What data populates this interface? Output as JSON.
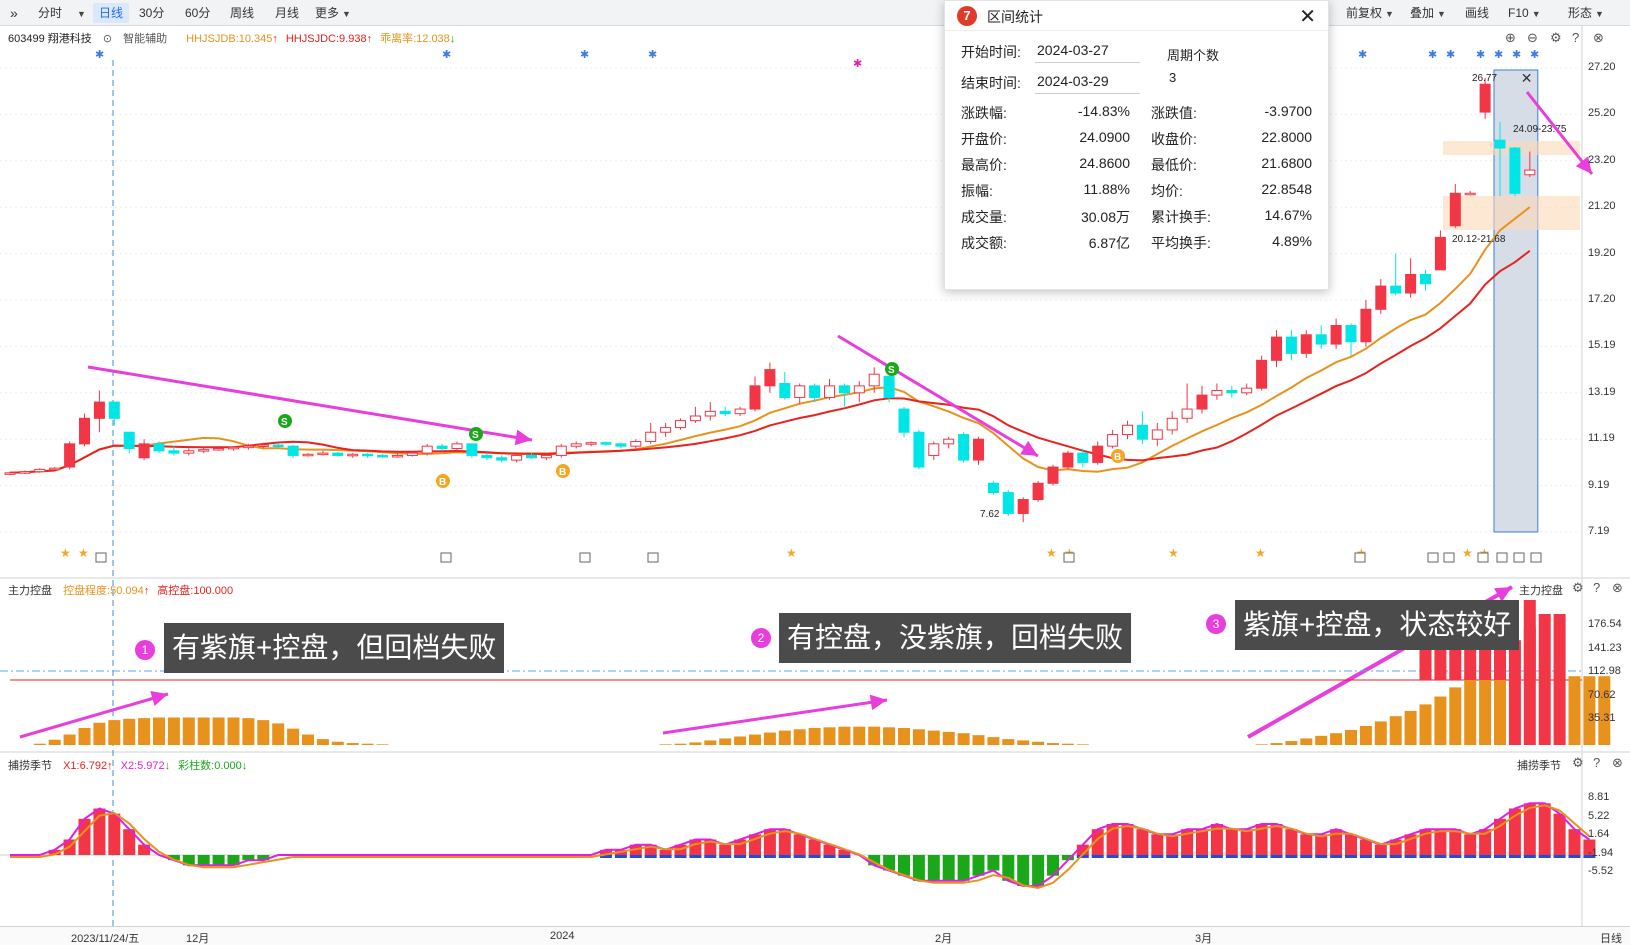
{
  "toolbar": {
    "expand_icon": "double-chevron-right-icon",
    "periods": [
      "分时",
      "日线",
      "30分",
      "60分",
      "周线",
      "月线",
      "更多"
    ],
    "active_period": "日线",
    "right": [
      "前复权",
      "叠加",
      "画线",
      "F10",
      "形态"
    ]
  },
  "stock": {
    "code_name": "603499 翔港科技",
    "assist": "智能辅助"
  },
  "main_indicators": [
    {
      "label": "HHJSJDB:10.345",
      "color": "#e8921e",
      "arrow": "↑",
      "arrow_color": "#e8221e"
    },
    {
      "label": "HHJSJDC:9.938",
      "color": "#e8221e",
      "arrow": "↑",
      "arrow_color": "#e8221e"
    },
    {
      "label": "乖离率:12.038",
      "color": "#e8921e",
      "arrow": "↓",
      "arrow_color": "#1aa81a"
    }
  ],
  "price_axis": [
    "27.20",
    "25.20",
    "23.20",
    "21.20",
    "19.20",
    "17.20",
    "15.19",
    "13.19",
    "11.19",
    "9.19",
    "7.19"
  ],
  "price_annotations": {
    "high": "26.77",
    "range1": "24.09-23.75",
    "range2": "20.12-21.68",
    "low": "7.62"
  },
  "control_panel": {
    "name": "主力控盘",
    "indicators": [
      {
        "label": "控盘程度:50.094",
        "color": "#e8921e",
        "arrow": "↑",
        "arrow_color": "#e8221e"
      },
      {
        "label": "高控盘:100.000",
        "color": "#e8221e"
      }
    ],
    "axis": [
      "176.54",
      "141.23",
      "112.98",
      "70.62",
      "35.31"
    ],
    "right_label": "主力控盘"
  },
  "season_panel": {
    "name": "捕捞季节",
    "indicators": [
      {
        "label": "X1:6.792",
        "color": "#e8221e",
        "arrow": "↑",
        "arrow_color": "#e8221e"
      },
      {
        "label": "X2:5.972",
        "color": "#e020e0",
        "arrow": "↓",
        "arrow_color": "#1aa81a"
      },
      {
        "label": "彩柱数:0.000",
        "color": "#1aa81a",
        "arrow": "↓",
        "arrow_color": "#1aa81a"
      }
    ],
    "axis": [
      "8.81",
      "5.22",
      "1.64",
      "-1.94",
      "-5.52"
    ],
    "right_label": "捕捞季节"
  },
  "dates": [
    "2023/11/24/五",
    "12月",
    "2024",
    "2月",
    "3月"
  ],
  "period_label": "日线",
  "stats": {
    "title": "区间统计",
    "start_label": "开始时间:",
    "start_value": "2024-03-27",
    "end_label": "结束时间:",
    "end_value": "2024-03-29",
    "period_count_label": "周期个数",
    "period_count": "3",
    "rows": [
      [
        "涨跌幅:",
        "-14.83%",
        "涨跌值:",
        "-3.9700"
      ],
      [
        "开盘价:",
        "24.0900",
        "收盘价:",
        "22.8000"
      ],
      [
        "最高价:",
        "24.8600",
        "最低价:",
        "21.6800"
      ],
      [
        "振幅:",
        "11.88%",
        "均价:",
        "22.8548"
      ],
      [
        "成交量:",
        "30.08万",
        "累计换手:",
        "14.67%"
      ],
      [
        "成交额:",
        "6.87亿",
        "平均换手:",
        "4.89%"
      ]
    ]
  },
  "annotations": [
    {
      "num": "1",
      "text": "有紫旗+控盘，但回档失败"
    },
    {
      "num": "2",
      "text": "有控盘，没紫旗，回档失败"
    },
    {
      "num": "3",
      "text": "紫旗+控盘，状态较好"
    }
  ],
  "colors": {
    "up": "#f23645",
    "down": "#00e5e5",
    "ma1": "#e8921e",
    "ma2": "#e8221e",
    "arrow": "#e83edc",
    "bar": "#e8921e",
    "green": "#1aa81a"
  },
  "chart_data": {
    "type": "candlestick",
    "candles": [
      [
        9.7,
        9.75,
        9.8,
        9.65
      ],
      [
        9.75,
        9.8,
        9.85,
        9.7
      ],
      [
        9.8,
        9.9,
        9.95,
        9.75
      ],
      [
        9.9,
        9.95,
        10.0,
        9.85
      ],
      [
        10.0,
        11.0,
        11.1,
        9.9
      ],
      [
        11.0,
        12.1,
        12.3,
        10.9
      ],
      [
        12.1,
        12.8,
        13.3,
        11.5
      ],
      [
        12.8,
        12.1,
        12.5,
        11.8
      ],
      [
        11.5,
        10.8,
        11.2,
        10.6
      ],
      [
        10.4,
        11.0,
        11.2,
        10.3
      ],
      [
        11.0,
        10.7,
        11.1,
        10.6
      ],
      [
        10.7,
        10.6,
        10.9,
        10.5
      ],
      [
        10.6,
        10.7,
        10.8,
        10.5
      ],
      [
        10.7,
        10.75,
        10.85,
        10.6
      ],
      [
        10.75,
        10.8,
        10.9,
        10.7
      ],
      [
        10.8,
        10.85,
        10.9,
        10.7
      ],
      [
        10.85,
        10.9,
        11.0,
        10.75
      ],
      [
        10.9,
        10.95,
        11.05,
        10.8
      ],
      [
        10.95,
        10.9,
        11.0,
        10.8
      ],
      [
        10.9,
        10.5,
        10.95,
        10.4
      ],
      [
        10.5,
        10.55,
        10.6,
        10.45
      ],
      [
        10.55,
        10.6,
        10.7,
        10.5
      ],
      [
        10.6,
        10.5,
        10.65,
        10.45
      ],
      [
        10.5,
        10.55,
        10.6,
        10.4
      ],
      [
        10.55,
        10.5,
        10.6,
        10.4
      ],
      [
        10.5,
        10.45,
        10.55,
        10.4
      ],
      [
        10.45,
        10.5,
        10.6,
        10.4
      ],
      [
        10.5,
        10.6,
        10.7,
        10.45
      ],
      [
        10.6,
        10.9,
        11.0,
        10.5
      ],
      [
        10.9,
        10.8,
        11.0,
        10.7
      ],
      [
        10.8,
        11.0,
        11.1,
        10.7
      ],
      [
        11.0,
        10.5,
        11.0,
        10.4
      ],
      [
        10.5,
        10.4,
        10.6,
        10.3
      ],
      [
        10.4,
        10.3,
        10.5,
        10.2
      ],
      [
        10.3,
        10.5,
        10.6,
        10.2
      ],
      [
        10.5,
        10.4,
        10.6,
        10.35
      ],
      [
        10.4,
        10.5,
        10.6,
        10.3
      ],
      [
        10.5,
        10.9,
        11.0,
        10.4
      ],
      [
        10.9,
        11.0,
        11.1,
        10.8
      ],
      [
        11.0,
        11.05,
        11.1,
        10.9
      ],
      [
        11.05,
        11.0,
        11.1,
        10.9
      ],
      [
        11.0,
        10.9,
        11.05,
        10.8
      ],
      [
        10.9,
        11.1,
        11.2,
        10.8
      ],
      [
        11.1,
        11.5,
        11.9,
        11.0
      ],
      [
        11.5,
        11.7,
        11.9,
        11.3
      ],
      [
        11.7,
        12.0,
        12.1,
        11.6
      ],
      [
        12.0,
        12.2,
        12.6,
        11.9
      ],
      [
        12.2,
        12.4,
        12.8,
        12.0
      ],
      [
        12.4,
        12.3,
        12.6,
        12.2
      ],
      [
        12.3,
        12.5,
        12.6,
        12.2
      ],
      [
        12.5,
        13.5,
        13.9,
        12.4
      ],
      [
        13.5,
        14.2,
        14.5,
        13.2
      ],
      [
        13.6,
        13.0,
        14.1,
        12.9
      ],
      [
        13.0,
        13.5,
        13.6,
        12.7
      ],
      [
        13.5,
        13.0,
        13.6,
        12.8
      ],
      [
        13.0,
        13.5,
        13.8,
        12.9
      ],
      [
        13.5,
        13.2,
        13.6,
        12.6
      ],
      [
        13.2,
        13.5,
        13.7,
        12.8
      ],
      [
        13.5,
        14.0,
        14.3,
        13.2
      ],
      [
        13.9,
        13.0,
        14.1,
        12.8
      ],
      [
        12.5,
        11.5,
        12.6,
        11.3
      ],
      [
        11.5,
        10.0,
        11.6,
        9.9
      ],
      [
        10.5,
        11.0,
        11.1,
        10.3
      ],
      [
        11.0,
        11.2,
        11.3,
        10.8
      ],
      [
        11.4,
        10.3,
        11.5,
        10.2
      ],
      [
        10.3,
        11.2,
        11.3,
        10.1
      ],
      [
        9.3,
        8.9,
        9.4,
        8.8
      ],
      [
        8.9,
        8.0,
        9.0,
        7.9
      ],
      [
        8.0,
        8.6,
        8.7,
        7.62
      ],
      [
        8.6,
        9.3,
        9.4,
        8.5
      ],
      [
        9.3,
        10.0,
        10.1,
        9.2
      ],
      [
        10.0,
        10.6,
        10.7,
        9.9
      ],
      [
        10.6,
        10.2,
        10.8,
        10.0
      ],
      [
        10.2,
        10.9,
        11.1,
        10.1
      ],
      [
        10.9,
        11.4,
        11.6,
        10.8
      ],
      [
        11.4,
        11.8,
        12.0,
        11.2
      ],
      [
        11.8,
        11.2,
        12.4,
        11.0
      ],
      [
        11.2,
        11.6,
        11.9,
        10.9
      ],
      [
        11.6,
        12.1,
        12.4,
        11.4
      ],
      [
        12.1,
        12.5,
        13.6,
        11.9
      ],
      [
        12.5,
        13.1,
        13.5,
        12.3
      ],
      [
        13.1,
        13.3,
        13.6,
        12.9
      ],
      [
        13.3,
        13.2,
        13.5,
        13.0
      ],
      [
        13.2,
        13.4,
        13.6,
        13.1
      ],
      [
        13.4,
        14.6,
        14.8,
        13.3
      ],
      [
        14.6,
        15.6,
        15.9,
        14.3
      ],
      [
        15.6,
        14.9,
        15.9,
        14.6
      ],
      [
        14.9,
        15.7,
        15.9,
        14.7
      ],
      [
        15.7,
        15.3,
        16.1,
        15.1
      ],
      [
        15.3,
        16.1,
        16.4,
        15.1
      ],
      [
        16.1,
        15.4,
        16.2,
        14.8
      ],
      [
        15.4,
        16.8,
        17.2,
        15.2
      ],
      [
        16.8,
        17.8,
        18.1,
        16.6
      ],
      [
        17.8,
        17.5,
        19.2,
        17.4
      ],
      [
        17.5,
        18.3,
        19.0,
        17.3
      ],
      [
        18.3,
        17.9,
        18.5,
        17.6
      ],
      [
        18.5,
        19.9,
        20.2,
        19.0
      ],
      [
        20.4,
        21.8,
        22.2,
        20.3
      ],
      [
        21.8,
        21.8,
        21.9,
        21.7
      ],
      [
        25.3,
        26.5,
        26.77,
        25.0
      ],
      [
        24.09,
        23.75,
        24.86,
        21.68
      ],
      [
        23.75,
        21.8,
        23.8,
        21.68
      ],
      [
        22.6,
        22.8,
        23.6,
        22.5
      ]
    ]
  }
}
